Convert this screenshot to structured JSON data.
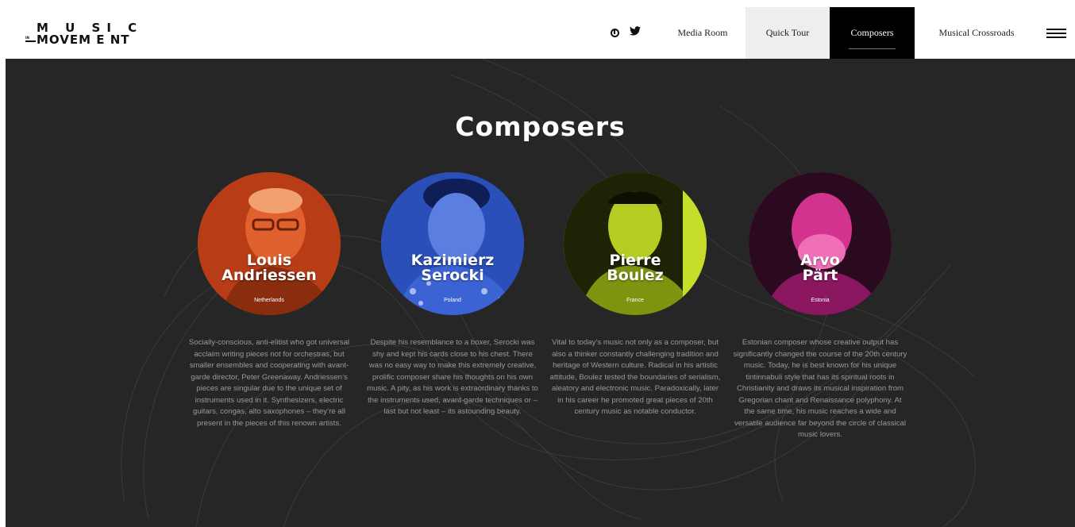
{
  "logo": {
    "line1": "M U SI C",
    "line2": "MOVEM E NT",
    "small": "IN"
  },
  "social": {
    "instagram": "instagram-icon",
    "twitter": "twitter-icon"
  },
  "nav": {
    "items": [
      "Media Room",
      "Quick Tour",
      "Composers",
      "Musical Crossroads"
    ],
    "active": "Composers"
  },
  "page": {
    "title": "Composers"
  },
  "colors": {
    "accent_orange": "#d94a1c",
    "accent_blue": "#2f57c9",
    "accent_green": "#a8c21a",
    "accent_pink": "#cc2a8a",
    "background": "#262626"
  },
  "composers": [
    {
      "name_line1": "Louis",
      "name_line2": "Andriessen",
      "country": "Netherlands",
      "description": "Socially-conscious, anti-elitist who got universal acclaim writing pieces not for orchestras, but smaller ensembles and cooperating with avant-garde director, Peter Greenaway. Andriessen’s pieces are singular due to the unique set of instruments used in it. Synthesizers, electric guitars, congas, alto saxophones – they’re all present in the pieces of this renown artists."
    },
    {
      "name_line1": "Kazimierz",
      "name_line2": "Serocki",
      "country": "Poland",
      "description": "Despite his resemblance to a boxer, Serocki was shy and kept his cards close to his chest. There was no easy way to make this extremely creative, prolific composer share his thoughts on his own music. A pity, as his work is extraordinary thanks to the instruments used, avant-garde techniques or – last but not least – its astounding beauty."
    },
    {
      "name_line1": "Pierre",
      "name_line2": "Boulez",
      "country": "France",
      "description": "Vital to today’s music not only as a composer, but also a thinker constantly challenging tradition and heritage of Western culture. Radical in his artistic attitude, Boulez tested the boundaries of serialism, aleatory and electronic music. Paradoxically, later in his career he promoted great pieces of 20th century music as notable conductor."
    },
    {
      "name_line1": "Arvo",
      "name_line2": "Pärt",
      "country": "Estonia",
      "description": "Estonian composer whose creative output has significantly changed the course of the 20th century music. Today, he is best known for his unique tintinnabuli style that has its spiritual roots in Christianity and draws its musical inspiration from Gregorian chant and Renaissance polyphony. At the same time, his music reaches a wide and versatile audience far beyond the circle of classical music lovers."
    }
  ]
}
